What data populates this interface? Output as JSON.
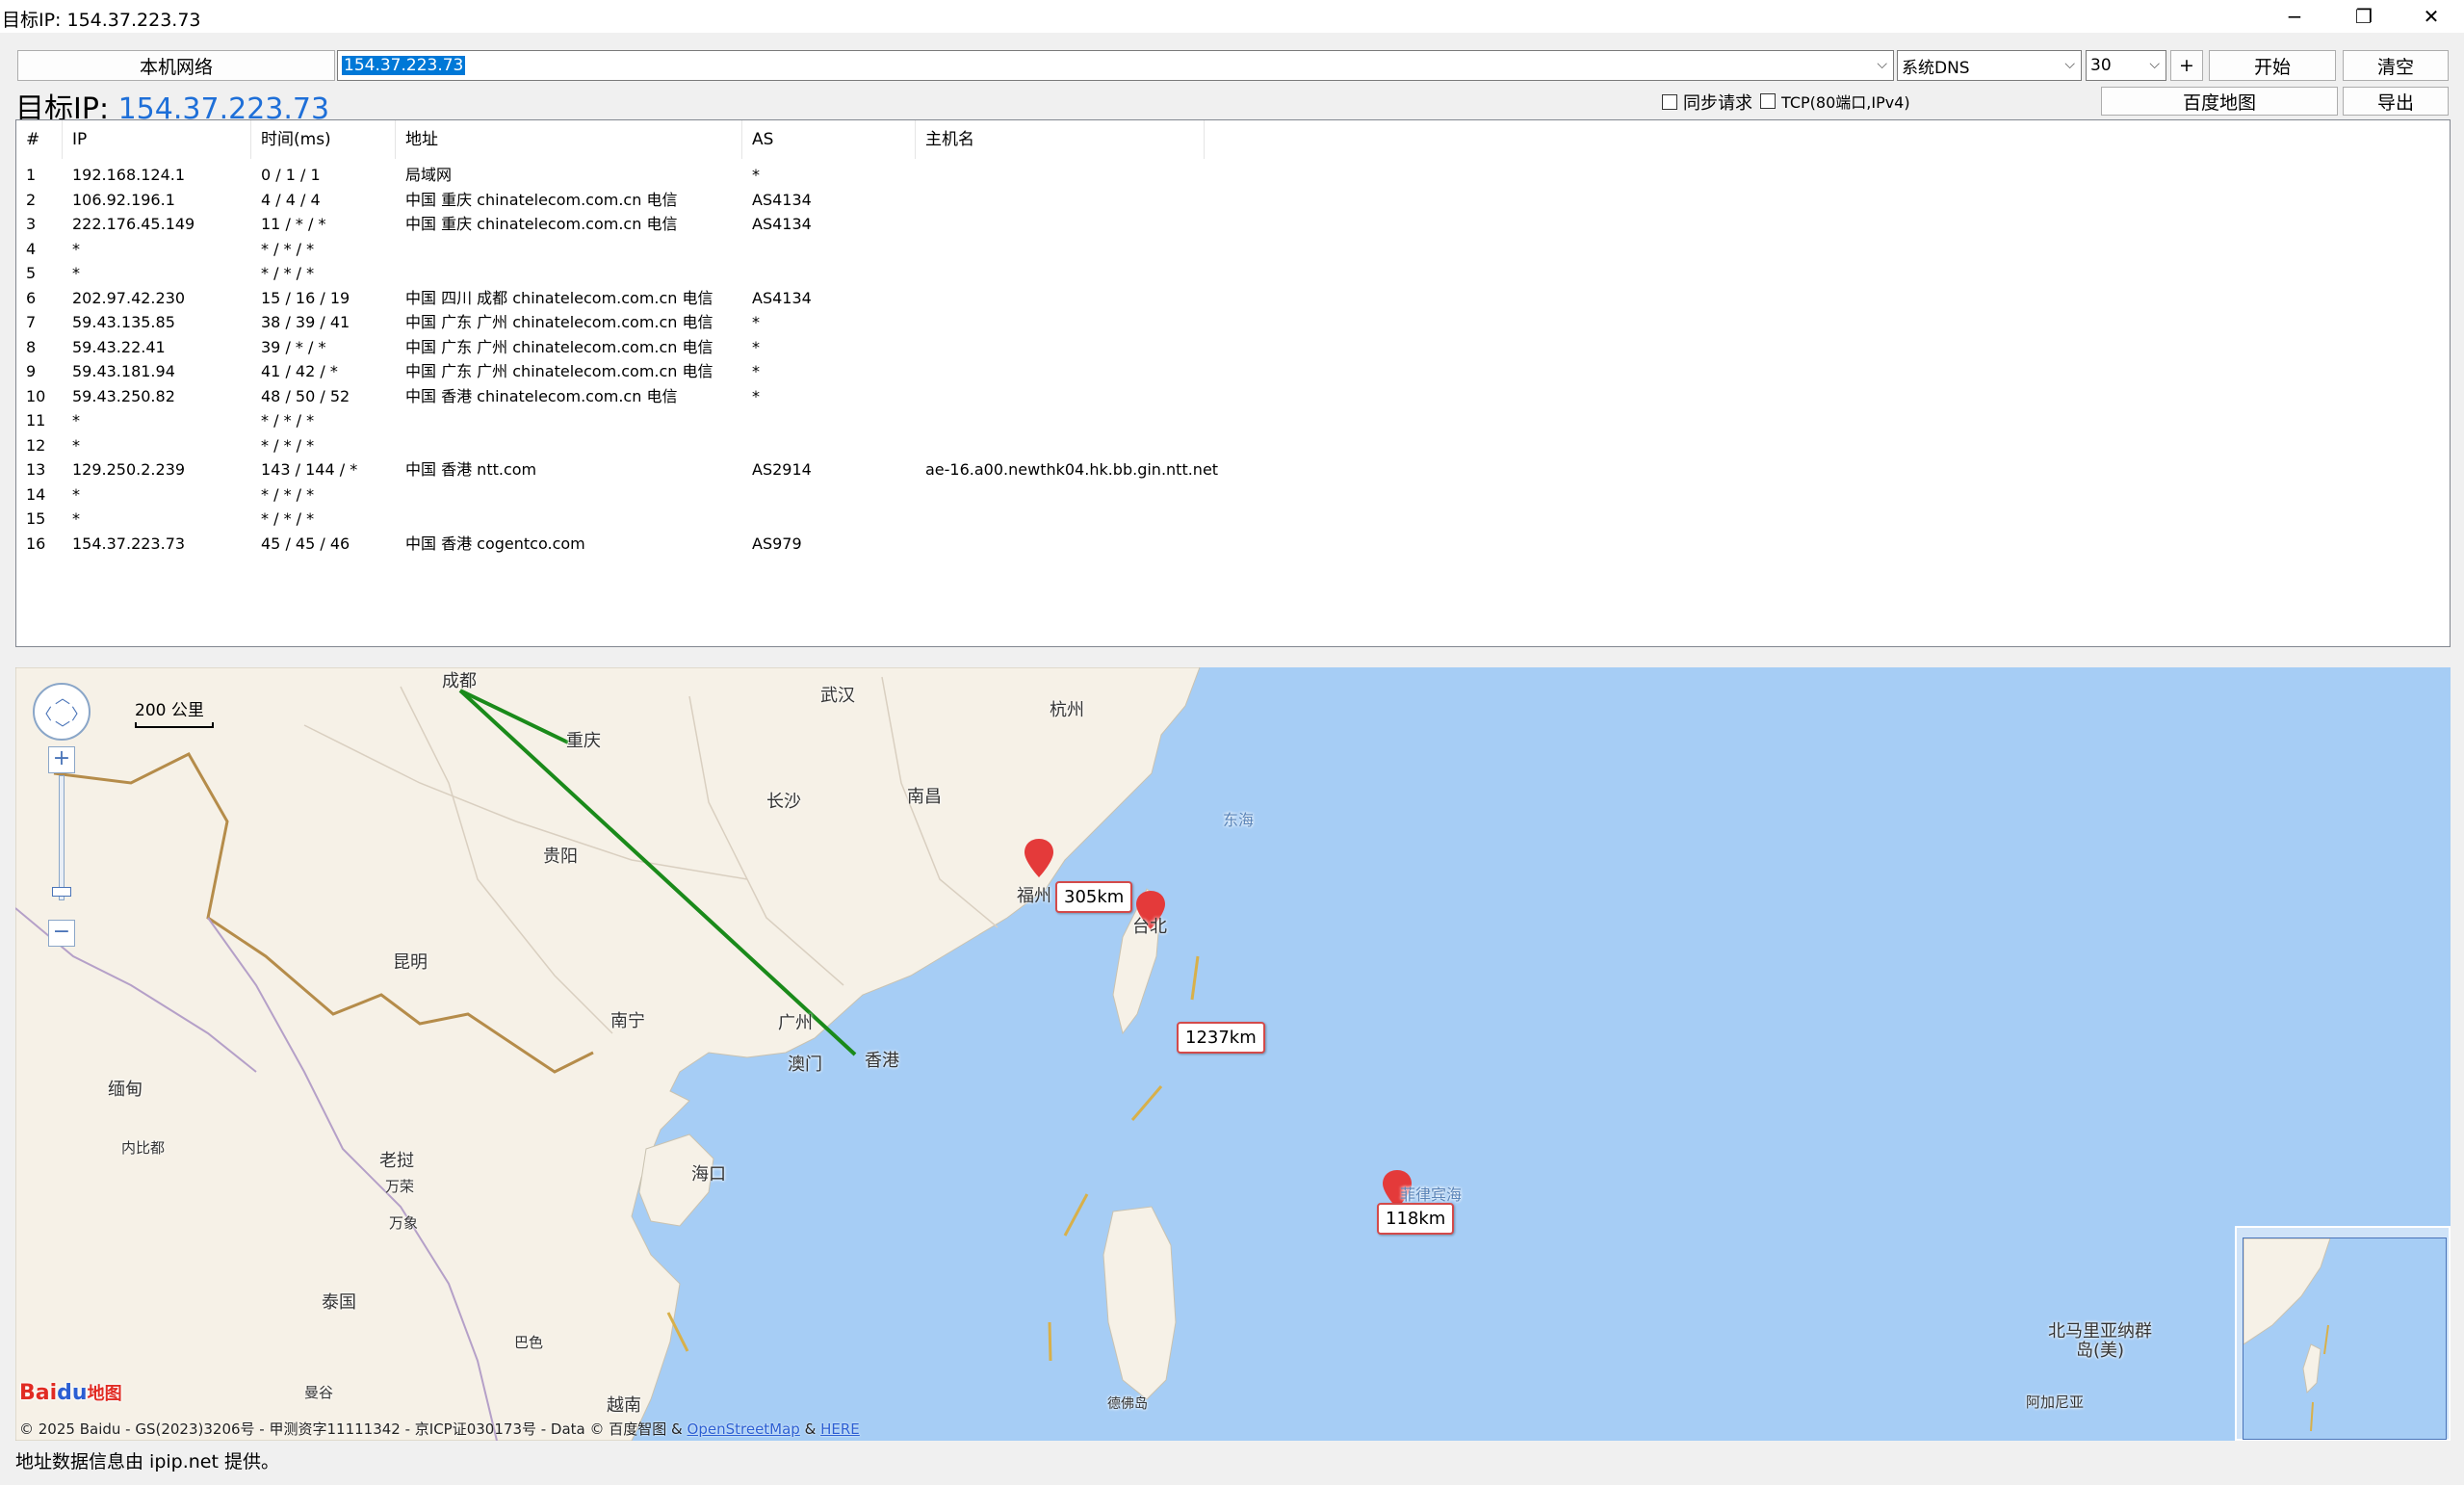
{
  "window": {
    "title": "目标IP: 154.37.223.73",
    "minimize": "−",
    "restore": "❐",
    "close": "✕"
  },
  "toolbar": {
    "local_network_label": "本机网络",
    "target_input_value": "154.37.223.73",
    "dns_value": "系统DNS",
    "max_hops_value": "30",
    "plus_label": "+",
    "start_label": "开始",
    "clear_label": "清空",
    "sync_request_label": "同步请求",
    "tcp_label": "TCP(80端口,IPv4)",
    "baidu_map_label": "百度地图",
    "export_label": "导出"
  },
  "target": {
    "prefix": "目标IP:",
    "ip": "154.37.223.73"
  },
  "table": {
    "headers": [
      "#",
      "IP",
      "时间(ms)",
      "地址",
      "AS",
      "主机名"
    ],
    "rows": [
      {
        "n": "1",
        "ip": "192.168.124.1",
        "time": "0 / 1 / 1",
        "addr": "局域网",
        "as": "*",
        "host": ""
      },
      {
        "n": "2",
        "ip": "106.92.196.1",
        "time": "4 / 4 / 4",
        "addr": "中国 重庆 chinatelecom.com.cn 电信",
        "as": "AS4134",
        "host": ""
      },
      {
        "n": "3",
        "ip": "222.176.45.149",
        "time": "11 / * / *",
        "addr": "中国 重庆 chinatelecom.com.cn 电信",
        "as": "AS4134",
        "host": ""
      },
      {
        "n": "4",
        "ip": "*",
        "time": "* / * / *",
        "addr": "",
        "as": "",
        "host": ""
      },
      {
        "n": "5",
        "ip": "*",
        "time": "* / * / *",
        "addr": "",
        "as": "",
        "host": ""
      },
      {
        "n": "6",
        "ip": "202.97.42.230",
        "time": "15 / 16 / 19",
        "addr": "中国 四川 成都 chinatelecom.com.cn 电信",
        "as": "AS4134",
        "host": ""
      },
      {
        "n": "7",
        "ip": "59.43.135.85",
        "time": "38 / 39 / 41",
        "addr": "中国 广东 广州 chinatelecom.com.cn 电信",
        "as": "*",
        "host": ""
      },
      {
        "n": "8",
        "ip": "59.43.22.41",
        "time": "39 / * / *",
        "addr": "中国 广东 广州 chinatelecom.com.cn 电信",
        "as": "*",
        "host": ""
      },
      {
        "n": "9",
        "ip": "59.43.181.94",
        "time": "41 / 42 / *",
        "addr": "中国 广东 广州 chinatelecom.com.cn 电信",
        "as": "*",
        "host": ""
      },
      {
        "n": "10",
        "ip": "59.43.250.82",
        "time": "48 / 50 / 52",
        "addr": "中国 香港 chinatelecom.com.cn 电信",
        "as": "*",
        "host": ""
      },
      {
        "n": "11",
        "ip": "*",
        "time": "* / * / *",
        "addr": "",
        "as": "",
        "host": ""
      },
      {
        "n": "12",
        "ip": "*",
        "time": "* / * / *",
        "addr": "",
        "as": "",
        "host": ""
      },
      {
        "n": "13",
        "ip": "129.250.2.239",
        "time": "143 / 144 / *",
        "addr": "中国 香港 ntt.com",
        "as": "AS2914",
        "host": "ae-16.a00.newthk04.hk.bb.gin.ntt.net"
      },
      {
        "n": "14",
        "ip": "*",
        "time": "* / * / *",
        "addr": "",
        "as": "",
        "host": ""
      },
      {
        "n": "15",
        "ip": "*",
        "time": "* / * / *",
        "addr": "",
        "as": "",
        "host": ""
      },
      {
        "n": "16",
        "ip": "154.37.223.73",
        "time": "45 / 45 / 46",
        "addr": "中国 香港 cogentco.com",
        "as": "AS979",
        "host": ""
      }
    ]
  },
  "map": {
    "scale_label": "200 公里",
    "zoom_in": "+",
    "zoom_out": "−",
    "cities": [
      "成都",
      "武汉",
      "杭州",
      "重庆",
      "长沙",
      "南昌",
      "东海",
      "贵阳",
      "福州",
      "台北",
      "昆明",
      "南宁",
      "广州",
      "澳门",
      "香港",
      "缅甸",
      "海口",
      "内比都",
      "老挝",
      "万荣",
      "万象",
      "泰国",
      "巴色",
      "曼谷",
      "越南",
      "北马里亚纳群岛(美)",
      "阿加尼亚",
      "德佛岛",
      "菲律宾海"
    ],
    "distances": [
      "305km",
      "1237km",
      "118km"
    ],
    "logo_text": "Bai",
    "logo_paw": "du",
    "logo_suffix": "地图",
    "copyright_text": "© 2025 Baidu - GS(2023)3206号 - 甲测资字11111342 - 京ICP证030173号 - Data © 百度智图 &",
    "osm_link": "OpenStreetMap",
    "amp": "&",
    "here_link": "HERE",
    "route_color": "#1a8a1a",
    "pin_color": "#e43a3a"
  },
  "status": {
    "text": "地址数据信息由 ipip.net 提供。"
  }
}
